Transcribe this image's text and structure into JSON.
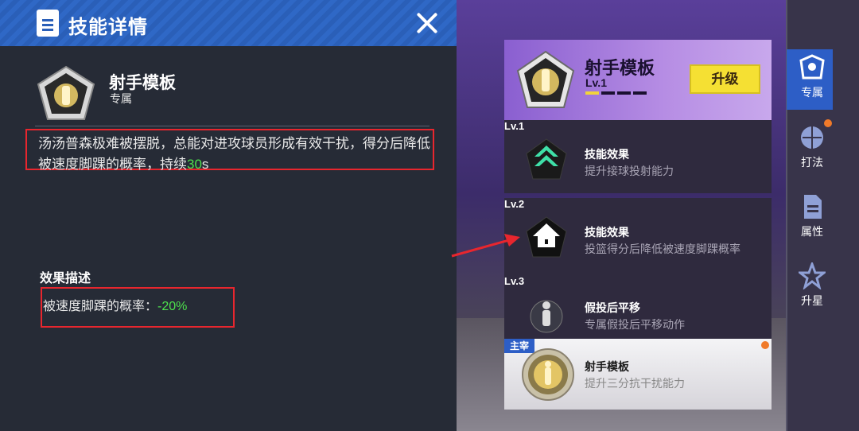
{
  "panel": {
    "header_title": "技能详情",
    "skill_name": "射手模板",
    "skill_type": "专属",
    "description_before": "汤汤普森极难被摆脱，总能对进攻球员形成有效干扰，得分后降低被速度脚踝的概率，持续",
    "description_duration": "30",
    "description_unit": "s",
    "effect_title": "效果描述",
    "effect_label": "被速度脚踝的概率：",
    "effect_value": "-20%"
  },
  "skill_card": {
    "name": "射手模板",
    "level": "Lv.1",
    "upgrade_label": "升级",
    "level_progress": 1,
    "level_max": 4
  },
  "levels": [
    {
      "tag": "Lv.1",
      "title": "技能效果",
      "subtitle": "提升接球投射能力"
    },
    {
      "tag": "Lv.2",
      "title": "技能效果",
      "subtitle": "投篮得分后降低被速度脚踝概率"
    },
    {
      "tag": "Lv.3",
      "title": "假投后平移",
      "subtitle": "专属假投后平移动作"
    }
  ],
  "main_skill": {
    "tag": "主宰",
    "title": "射手模板",
    "subtitle": "提升三分抗干扰能力"
  },
  "nav": {
    "items": [
      {
        "label": "专属",
        "icon": "team-badge-icon",
        "active": true
      },
      {
        "label": "打法",
        "icon": "basketball-player-icon",
        "active": false
      },
      {
        "label": "属性",
        "icon": "document-icon",
        "active": false
      },
      {
        "label": "升星",
        "icon": "star-icon",
        "active": false
      }
    ]
  },
  "colors": {
    "accent_blue": "#2d5ec6",
    "highlight_green": "#4de04d",
    "upgrade_yellow": "#f5e033",
    "annotation_red": "#e8262e"
  }
}
